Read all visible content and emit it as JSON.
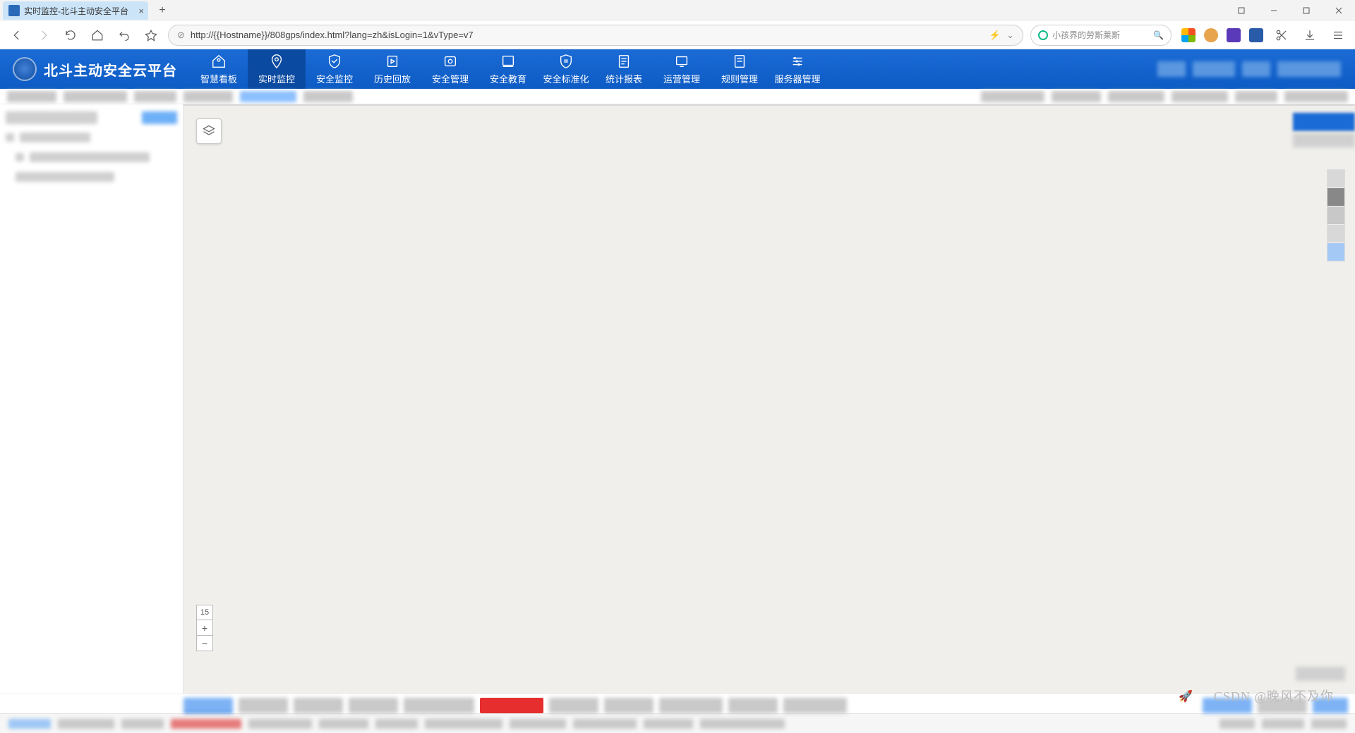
{
  "browser": {
    "tab_title": "实时监控-北斗主动安全平台",
    "new_tab": "+",
    "url": "http://{{Hostname}}/808gps/index.html?lang=zh&isLogin=1&vType=v7",
    "search_placeholder": "小孩界的劳斯莱斯"
  },
  "colors": {
    "header_bg": "#1b6bd6",
    "header_active": "#0a4aa0",
    "accent_red": "#e62e2e"
  },
  "app": {
    "title": "北斗主动安全云平台",
    "nav": [
      {
        "label": "智慧看板",
        "icon": "dashboard-icon"
      },
      {
        "label": "实时监控",
        "icon": "location-icon",
        "active": true
      },
      {
        "label": "安全监控",
        "icon": "shield-check-icon"
      },
      {
        "label": "历史回放",
        "icon": "playback-icon"
      },
      {
        "label": "安全管理",
        "icon": "safety-mgmt-icon"
      },
      {
        "label": "安全教育",
        "icon": "education-icon"
      },
      {
        "label": "安全标准化",
        "icon": "standard-icon"
      },
      {
        "label": "统计报表",
        "icon": "report-icon"
      },
      {
        "label": "运营管理",
        "icon": "operation-icon"
      },
      {
        "label": "规则管理",
        "icon": "rules-icon"
      },
      {
        "label": "服务器管理",
        "icon": "server-icon"
      }
    ]
  },
  "map": {
    "zoom_level": "15",
    "zoom_in": "+",
    "zoom_out": "−"
  },
  "watermark": "CSDN @晚风不及你",
  "toolbar_colors": [
    "#e88a30",
    "#4a7bc8",
    "#b84a9c"
  ]
}
